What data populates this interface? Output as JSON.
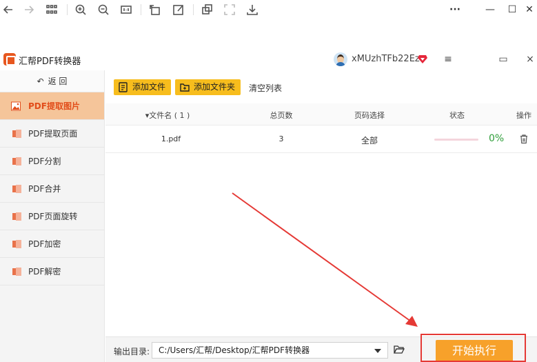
{
  "app": {
    "title": "汇帮PDF转换器",
    "username": "xMUzhTFb22Ez"
  },
  "window_controls": {
    "more": "···",
    "minimize": "—",
    "maximize": "☐",
    "close": "✕"
  },
  "app_controls": {
    "menu": "≡",
    "maximize": "▭",
    "close": "×"
  },
  "sidebar": {
    "back_label": "返 回",
    "items": [
      {
        "label": "PDF提取图片",
        "active": true
      },
      {
        "label": "PDF提取页面",
        "active": false
      },
      {
        "label": "PDF分割",
        "active": false
      },
      {
        "label": "PDF合并",
        "active": false
      },
      {
        "label": "PDF页面旋转",
        "active": false
      },
      {
        "label": "PDF加密",
        "active": false
      },
      {
        "label": "PDF解密",
        "active": false
      }
    ]
  },
  "toolbar": {
    "add_file": "添加文件",
    "add_folder": "添加文件夹",
    "clear_list": "清空列表"
  },
  "table": {
    "headers": {
      "filename": "▾文件名 ( 1 )",
      "pages": "总页数",
      "page_select": "页码选择",
      "status": "状态",
      "action": "操作"
    },
    "rows": [
      {
        "filename": "1.pdf",
        "pages": "3",
        "page_select": "全部",
        "progress": 0,
        "progress_text": "0%"
      }
    ]
  },
  "output": {
    "label": "输出目录:",
    "path": "C:/Users/汇帮/Desktop/汇帮PDF转换器"
  },
  "start_button": "开始执行",
  "colors": {
    "accent": "#f7bd1d",
    "active_nav_bg": "#f5c59a",
    "active_nav_text": "#e24d1a",
    "start_button": "#f7a12a",
    "progress_text": "#2f9e3a",
    "annotation": "#e53935"
  }
}
